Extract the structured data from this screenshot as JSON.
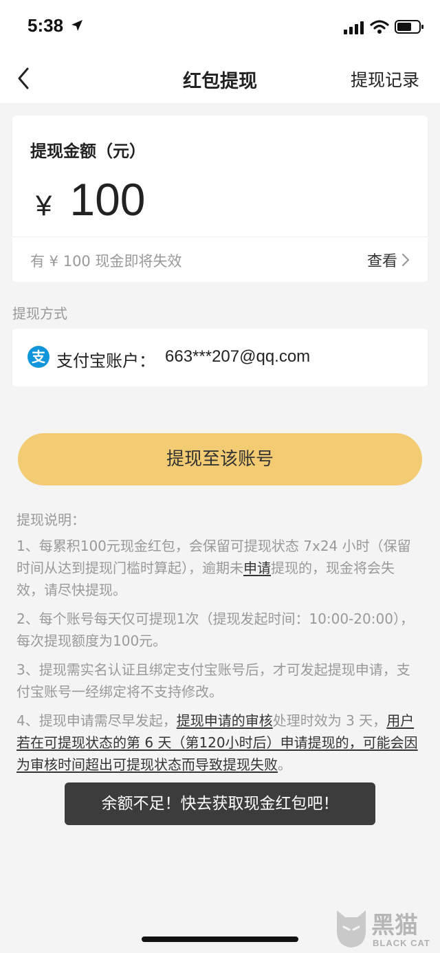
{
  "status_bar": {
    "time": "5:38"
  },
  "nav": {
    "title": "红包提现",
    "right_label": "提现记录"
  },
  "amount_card": {
    "label": "提现金额（元）",
    "currency": "¥",
    "value": "100",
    "expire_note": "有 ¥ 100 现金即将失效",
    "view_label": "查看"
  },
  "method": {
    "section_label": "提现方式",
    "account_label": "支付宝账户：",
    "account_value": "663***207@qq.com"
  },
  "withdraw_button": "提现至该账号",
  "notes": {
    "title": "提现说明：",
    "item1": {
      "part1": "1、每累积100元现金红包，会保留可提现状态 7x24 小时（保留时间从达到提现门槛时算起），逾期未",
      "link": "申请",
      "part2": "提现的，现金将会失效，请尽快提现。"
    },
    "item2": "2、每个账号每天仅可提现1次（提现发起时间：10:00-20:00），每次提现额度为100元。",
    "item3": "3、提现需实名认证且绑定支付宝账号后，才可发起提现申请，支付宝账号一经绑定将不支持修改。",
    "item4": {
      "part1": "4、提现申请需尽早发起，",
      "link1": "提现申请的审核",
      "part2": "处理时效为 3 天，",
      "link2": "用户若在可提现状态的第 6 天（第120小时后）申请提现的，可能会因为审核时间超出可提现状态而导致提现失败",
      "part3": "。"
    }
  },
  "toast": "余额不足！快去获取现金红包吧！",
  "watermark": {
    "cn": "黑猫",
    "en": "BLACK CAT"
  },
  "colors": {
    "button": "#f3cb73",
    "alipay": "#1296db",
    "toast_bg": "#323232"
  }
}
